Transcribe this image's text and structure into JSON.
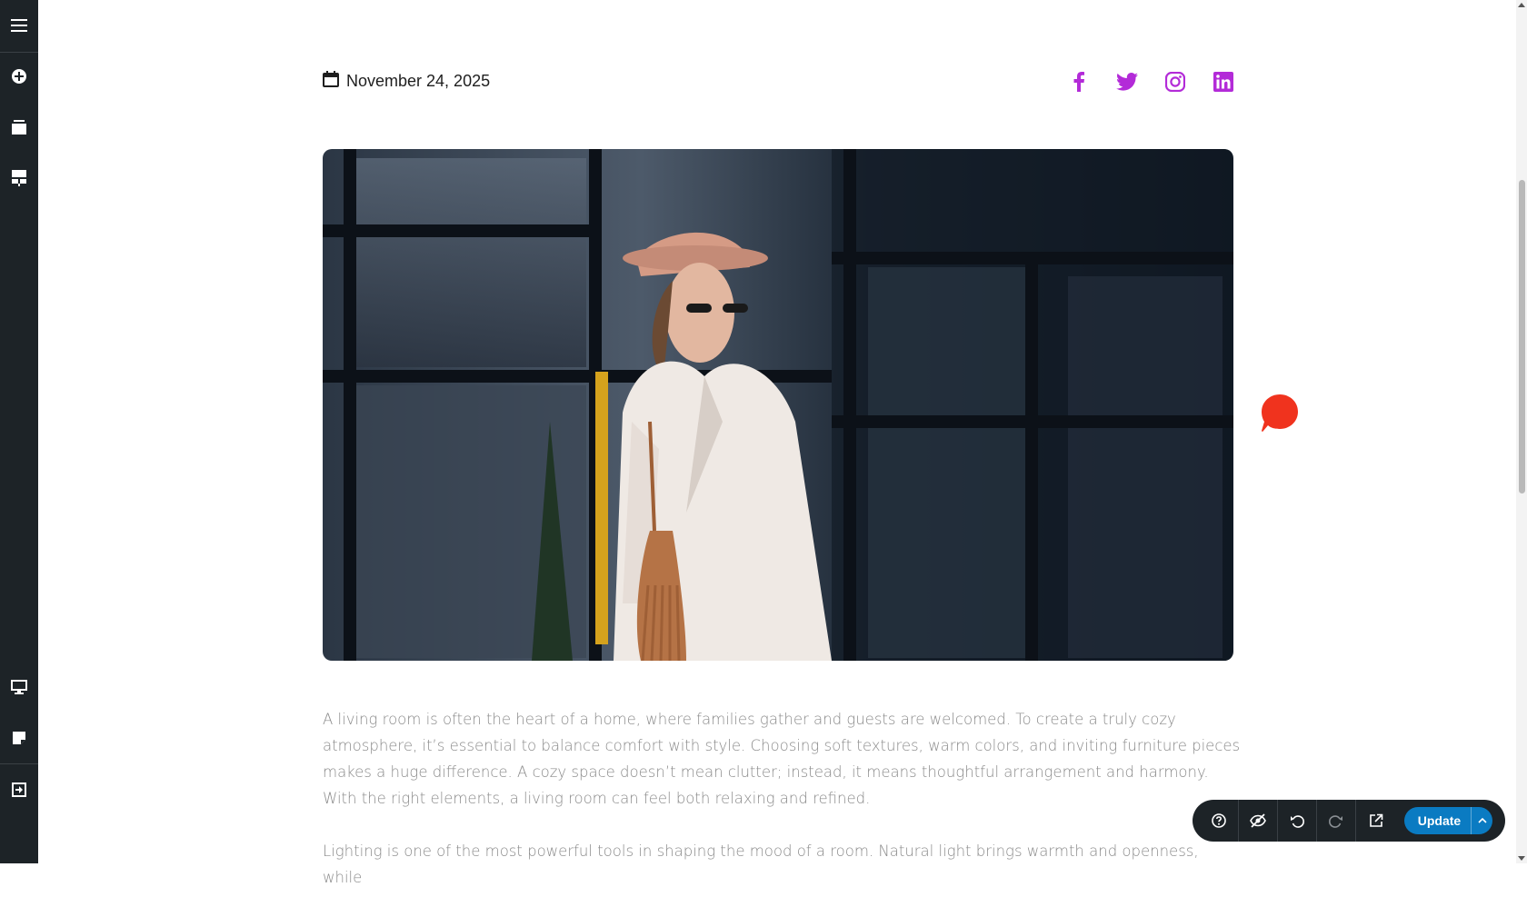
{
  "sidebar": {
    "top_icons": [
      "menu-icon",
      "add-circle-icon",
      "layers-icon",
      "template-icon"
    ],
    "bottom_icons": [
      "desktop-preview-icon",
      "notes-icon",
      "exit-icon"
    ]
  },
  "post": {
    "date": "November 24, 2025",
    "social": [
      "facebook-icon",
      "twitter-icon",
      "instagram-icon",
      "linkedin-icon"
    ],
    "social_color": "#b32bd8",
    "hero_alt": "Woman in white blazer and hat",
    "paragraphs": [
      "A living room is often the heart of a home, where families gather and guests are welcomed. To create a truly cozy atmosphere, it’s essential to balance comfort with style. Choosing soft textures, warm colors, and inviting furniture pieces makes a huge difference. A cozy space doesn’t mean clutter; instead, it means thoughtful arrangement and harmony. With the right elements, a living room can feel both relaxing and refined.",
      "Lighting is one of the most powerful tools in shaping the mood of a room. Natural light brings warmth and openness, while"
    ]
  },
  "chat": {
    "color": "#f0331e"
  },
  "toolbar": {
    "buttons": [
      "help-icon",
      "hide-icon",
      "undo-icon",
      "redo-icon",
      "external-link-icon"
    ],
    "update_label": "Update",
    "accent": "#0a7bc2"
  }
}
